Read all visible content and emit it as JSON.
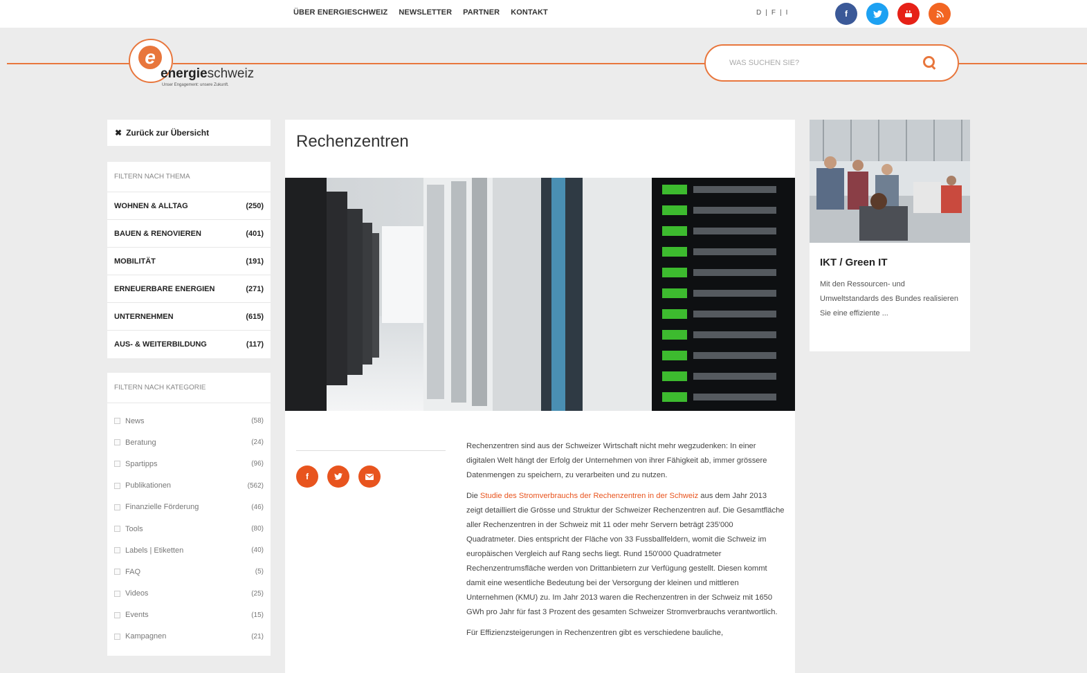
{
  "topnav": {
    "links": [
      "ÜBER ENERGIESCHWEIZ",
      "NEWSLETTER",
      "PARTNER",
      "KONTAKT"
    ],
    "languages": [
      "D",
      "|",
      "F",
      "|",
      "I"
    ]
  },
  "social": [
    "facebook-icon",
    "twitter-icon",
    "youtube-icon",
    "rss-icon"
  ],
  "logo": {
    "brand_bold": "energie",
    "brand_light": "schweiz",
    "tagline": "Unser Engagement: unsere Zukunft."
  },
  "search": {
    "placeholder": "WAS SUCHEN SIE?"
  },
  "sidebar": {
    "back_label": "Zurück zur Übersicht",
    "theme_heading": "FILTERN NACH THEMA",
    "themes": [
      {
        "label": "WOHNEN & ALLTAG",
        "count": "(250)"
      },
      {
        "label": "BAUEN & RENOVIEREN",
        "count": "(401)"
      },
      {
        "label": "MOBILITÄT",
        "count": "(191)"
      },
      {
        "label": "ERNEUERBARE ENERGIEN",
        "count": "(271)"
      },
      {
        "label": "UNTERNEHMEN",
        "count": "(615)"
      },
      {
        "label": "AUS- & WEITERBILDUNG",
        "count": "(117)"
      }
    ],
    "category_heading": "FILTERN NACH KATEGORIE",
    "categories": [
      {
        "label": "News",
        "count": "(58)"
      },
      {
        "label": "Beratung",
        "count": "(24)"
      },
      {
        "label": "Spartipps",
        "count": "(96)"
      },
      {
        "label": "Publikationen",
        "count": "(562)"
      },
      {
        "label": "Finanzielle Förderung",
        "count": "(46)"
      },
      {
        "label": "Tools",
        "count": "(80)"
      },
      {
        "label": "Labels | Etiketten",
        "count": "(40)"
      },
      {
        "label": "FAQ",
        "count": "(5)"
      },
      {
        "label": "Videos",
        "count": "(25)"
      },
      {
        "label": "Events",
        "count": "(15)"
      },
      {
        "label": "Kampagnen",
        "count": "(21)"
      }
    ]
  },
  "main": {
    "title": "Rechenzentren",
    "share": [
      "facebook-icon",
      "twitter-icon",
      "mail-icon"
    ],
    "para1": "Rechenzentren sind aus der Schweizer Wirtschaft nicht mehr wegzudenken: In einer digitalen Welt hängt der Erfolg der Unternehmen von ihrer Fähigkeit ab, immer grössere Datenmengen zu speichern, zu verarbeiten und zu nutzen.",
    "para2_pre": "Die ",
    "para2_link": "Studie des Stromverbrauchs der Rechenzentren in der Schweiz",
    "para2_post": " aus dem Jahr 2013 zeigt detailliert die Grösse und Struktur der Schweizer Rechenzentren auf. Die Gesamtfläche aller Rechenzentren in der Schweiz mit 11 oder mehr Servern beträgt 235'000 Quadratmeter. Dies entspricht der Fläche von 33 Fussballfeldern, womit die Schweiz im europäischen Vergleich auf Rang sechs liegt. Rund 150'000 Quadratmeter Rechenzentrumsfläche werden von Drittanbietern zur Verfügung gestellt. Diesen kommt damit eine wesentliche Bedeutung bei der Versorgung der kleinen und mittleren Unternehmen (KMU) zu. Im Jahr 2013 waren die Rechenzentren in der Schweiz mit 1650 GWh pro Jahr für fast 3 Prozent des gesamten Schweizer Stromverbrauchs verantwortlich.",
    "para3": "Für Effizienzsteigerungen in Rechenzentren gibt es verschiedene bauliche,"
  },
  "side_card": {
    "title": "IKT / Green IT",
    "text": "Mit den Ressourcen- und Umweltstandards des Bundes realisieren Sie eine effiziente ..."
  }
}
